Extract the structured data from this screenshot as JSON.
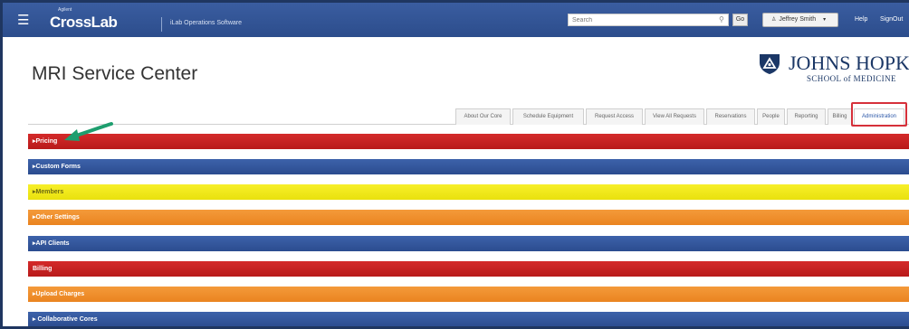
{
  "topbar": {
    "menu_icon": "hamburger-icon",
    "brand_agilent": "Agilent",
    "brand_name": "CrossLab",
    "brand_sub": "iLab Operations Software",
    "search_placeholder": "Search",
    "search_icon": "search-icon",
    "go_label": "Go",
    "user_icon": "person-icon",
    "user_label": "Jeffrey Smith",
    "caret": "▾",
    "help_label": "Help",
    "signout_label": "SignOut"
  },
  "page": {
    "title": "MRI Service Center"
  },
  "logo": {
    "name": "JOHNS HOPKINS",
    "sub": "SCHOOL of MEDICINE",
    "shield_icon": "university-shield-icon"
  },
  "tabs": [
    {
      "label": "About Our Core",
      "active": false
    },
    {
      "label": "Schedule Equipment",
      "active": false
    },
    {
      "label": "Request Access",
      "active": false
    },
    {
      "label": "View All Requests",
      "active": false
    },
    {
      "label": "Reservations",
      "active": false
    },
    {
      "label": "People",
      "active": false
    },
    {
      "label": "Reporting",
      "active": false
    },
    {
      "label": "Billing",
      "active": false
    },
    {
      "label": "Administration",
      "active": true
    }
  ],
  "sections": [
    {
      "label": "▸Pricing",
      "color": "red"
    },
    {
      "label": "▸Custom Forms",
      "color": "blue"
    },
    {
      "label": "▸Members",
      "color": "yellow"
    },
    {
      "label": "▸Other Settings",
      "color": "orange"
    },
    {
      "label": "▸API Clients",
      "color": "blue"
    },
    {
      "label": "Billing",
      "color": "red"
    },
    {
      "label": "▸Upload Charges",
      "color": "orange"
    },
    {
      "label": "▸ Collaborative Cores",
      "color": "blue"
    }
  ],
  "colors": {
    "topbar": "#2c4d8c",
    "red": "#c62020",
    "blue": "#33559b",
    "yellow": "#f0e81c",
    "orange": "#ee8e2c",
    "highlight": "#d6303a",
    "arrow": "#1e9e6e"
  },
  "annotations": {
    "arrow_icon": "pointer-arrow-icon",
    "highlight_target": "Administration"
  }
}
